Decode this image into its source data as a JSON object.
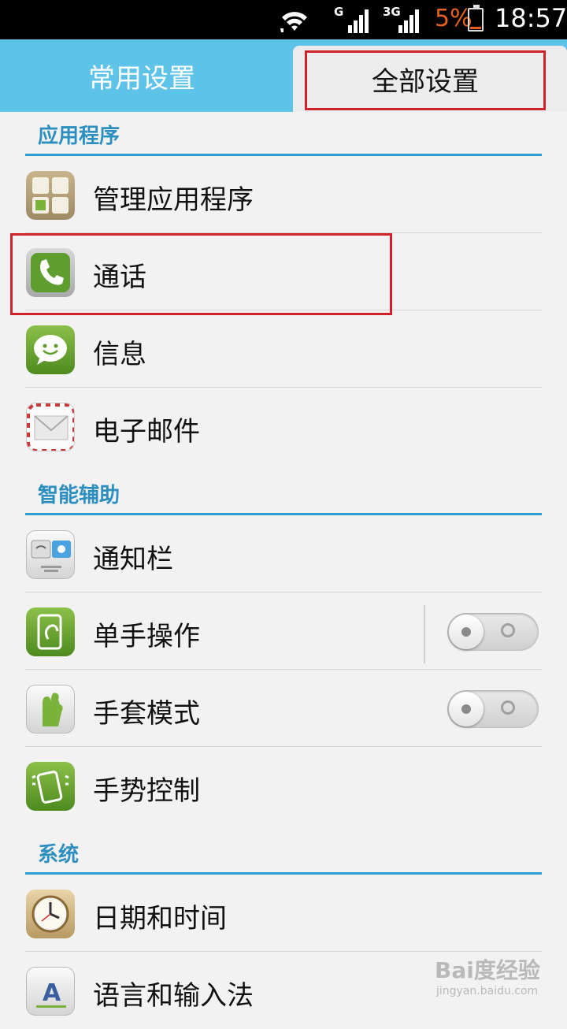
{
  "status_bar": {
    "network_1": "G",
    "network_2": "3G",
    "battery": "5%",
    "battery_color": "#e8601e",
    "time": "18:57",
    "icons": [
      "wifi-icon",
      "signal-icon",
      "signal-3g-icon",
      "battery-low-icon"
    ]
  },
  "tabs": {
    "common": "常用设置",
    "all": "全部设置",
    "selected": "all"
  },
  "sections": [
    {
      "title": "应用程序",
      "items": [
        {
          "label": "管理应用程序",
          "icon": "apps-grid-icon"
        },
        {
          "label": "通话",
          "icon": "phone-icon"
        },
        {
          "label": "信息",
          "icon": "message-icon"
        },
        {
          "label": "电子邮件",
          "icon": "mail-icon"
        }
      ]
    },
    {
      "title": "智能辅助",
      "items": [
        {
          "label": "通知栏",
          "icon": "notification-bar-icon"
        },
        {
          "label": "单手操作",
          "icon": "one-hand-icon",
          "toggle": false
        },
        {
          "label": "手套模式",
          "icon": "glove-icon",
          "toggle": false
        },
        {
          "label": "手势控制",
          "icon": "gesture-icon"
        }
      ]
    },
    {
      "title": "系统",
      "items": [
        {
          "label": "日期和时间",
          "icon": "clock-icon"
        },
        {
          "label": "语言和输入法",
          "icon": "language-icon"
        }
      ]
    }
  ],
  "colors": {
    "accent": "#2d9fd2",
    "tab_bar": "#5ec3e8",
    "highlight_box": "#d0202a"
  },
  "watermark": {
    "text": "Bai度经验",
    "sub": "jingyan.baidu.com"
  }
}
